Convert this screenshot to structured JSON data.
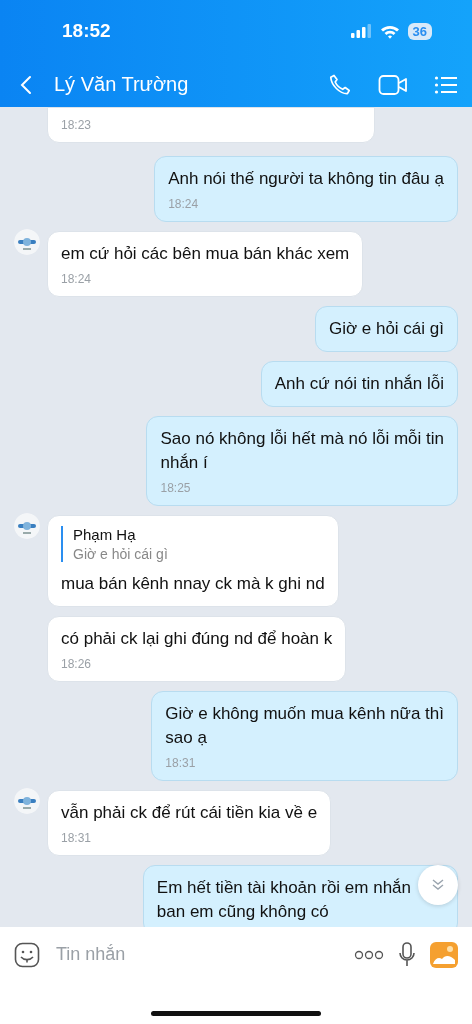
{
  "status_bar": {
    "time": "18:52",
    "battery": "36"
  },
  "header": {
    "title": "Lý Văn Trường"
  },
  "messages": [
    {
      "kind": "in",
      "avatar": false,
      "time": "18:23"
    },
    {
      "kind": "out",
      "text": "Anh nói thế người ta không tin đâu ạ",
      "time": "18:24"
    },
    {
      "kind": "in",
      "avatar": true,
      "text": "em cứ hỏi các bên mua bán khác xem",
      "time": "18:24"
    },
    {
      "kind": "out",
      "text": "Giờ e hỏi cái gì"
    },
    {
      "kind": "out",
      "text": "Anh cứ nói tin nhắn lỗi"
    },
    {
      "kind": "out",
      "text": "Sao nó không lỗi hết mà nó lỗi mỗi tin\nnhắn í",
      "time": "18:25"
    },
    {
      "kind": "in",
      "avatar": true,
      "quote": {
        "name": "Phạm Hạ",
        "text": "Giờ e hỏi cái gì"
      },
      "text": "mua bán kênh nnay ck mà k ghi nd"
    },
    {
      "kind": "in",
      "avatar": false,
      "text": "có phải ck lại ghi đúng nd để hoàn k",
      "time": "18:26"
    },
    {
      "kind": "out",
      "text": "Giờ e không muốn mua kênh nữa thì\nsao ạ",
      "time": "18:31"
    },
    {
      "kind": "in",
      "avatar": true,
      "text": "vẫn phải ck để rút cái tiền kia về e",
      "time": "18:31"
    },
    {
      "kind": "out",
      "text": "Em hết tiền tài khoản rồi em nhắn\nban em cũng không có"
    }
  ],
  "composer": {
    "placeholder": "Tin nhắn"
  }
}
